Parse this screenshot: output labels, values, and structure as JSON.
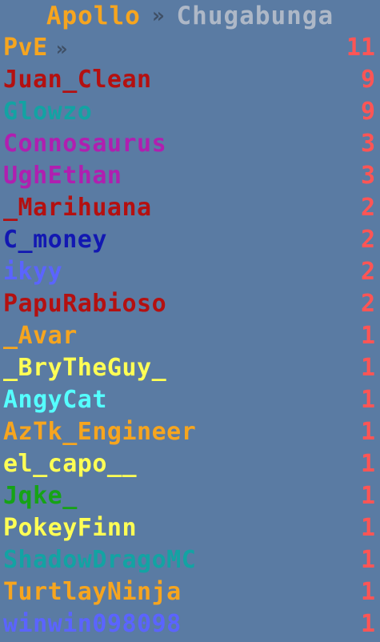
{
  "header": {
    "server": "Apollo",
    "separator": "»",
    "player": "Chugabunga"
  },
  "section": {
    "label": "PvE",
    "separator": "»",
    "score": "11",
    "color": "#f6a51f"
  },
  "players": [
    {
      "name": "Juan_Clean",
      "score": "9",
      "color": "#b41010"
    },
    {
      "name": "Glowzo",
      "score": "9",
      "color": "#13a3a3"
    },
    {
      "name": "Connosaurus",
      "score": "3",
      "color": "#b01fb0"
    },
    {
      "name": "UghEthan",
      "score": "3",
      "color": "#b01fb0"
    },
    {
      "name": "_Marihuana",
      "score": "2",
      "color": "#b41010"
    },
    {
      "name": "C_money",
      "score": "2",
      "color": "#1218b2"
    },
    {
      "name": "ikyy",
      "score": "2",
      "color": "#5b64ff"
    },
    {
      "name": "PapuRabioso",
      "score": "2",
      "color": "#b41010"
    },
    {
      "name": "_Avar",
      "score": "1",
      "color": "#f6a51f"
    },
    {
      "name": "_BryTheGuy_",
      "score": "1",
      "color": "#ffff55"
    },
    {
      "name": "AngyCat",
      "score": "1",
      "color": "#55ffff"
    },
    {
      "name": "AzTk_Engineer",
      "score": "1",
      "color": "#f6a51f"
    },
    {
      "name": "el_capo__",
      "score": "1",
      "color": "#ffff55"
    },
    {
      "name": "Jqke_",
      "score": "1",
      "color": "#16a316"
    },
    {
      "name": "PokeyFinn",
      "score": "1",
      "color": "#ffff55"
    },
    {
      "name": "ShadowDragoMC",
      "score": "1",
      "color": "#13a3a3"
    },
    {
      "name": "TurtlayNinja",
      "score": "1",
      "color": "#f6a51f"
    },
    {
      "name": "winwin098098",
      "score": "1",
      "color": "#5b64ff"
    }
  ],
  "score_color": "#ff5555"
}
